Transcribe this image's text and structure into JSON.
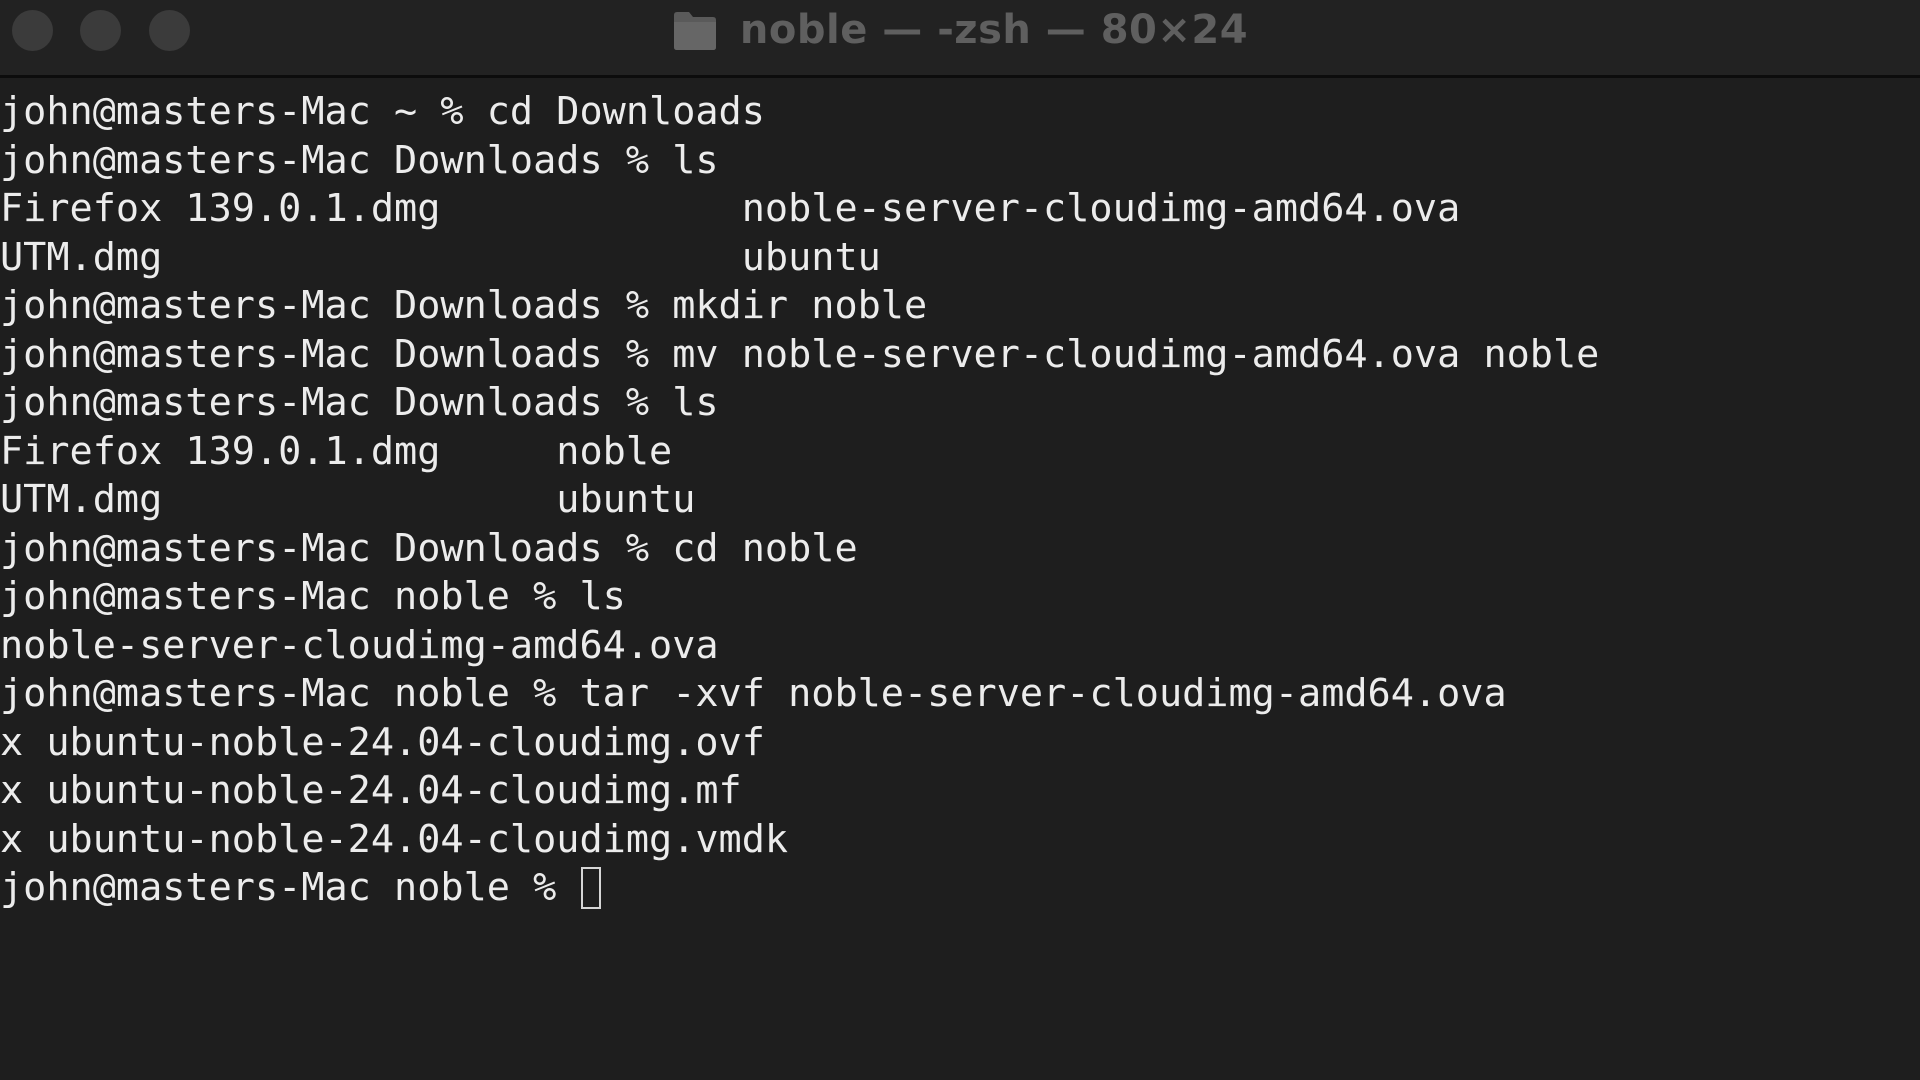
{
  "window": {
    "title": "noble — -zsh — 80×24",
    "title_icon": "folder-icon",
    "buttons": [
      "close",
      "minimize",
      "zoom"
    ]
  },
  "colors": {
    "background": "#1e1e1e",
    "titlebar": "#222222",
    "text": "#ececec",
    "title_text": "#5f5f5f",
    "traffic_light": "#3b3b3b"
  },
  "terminal": {
    "lines": [
      "john@masters-Mac ~ % cd Downloads",
      "john@masters-Mac Downloads % ls",
      "Firefox 139.0.1.dmg             noble-server-cloudimg-amd64.ova",
      "UTM.dmg                         ubuntu",
      "john@masters-Mac Downloads % mkdir noble",
      "john@masters-Mac Downloads % mv noble-server-cloudimg-amd64.ova noble",
      "john@masters-Mac Downloads % ls",
      "Firefox 139.0.1.dmg     noble",
      "UTM.dmg                 ubuntu",
      "john@masters-Mac Downloads % cd noble",
      "john@masters-Mac noble % ls",
      "noble-server-cloudimg-amd64.ova",
      "john@masters-Mac noble % tar -xvf noble-server-cloudimg-amd64.ova",
      "x ubuntu-noble-24.04-cloudimg.ovf",
      "x ubuntu-noble-24.04-cloudimg.mf",
      "x ubuntu-noble-24.04-cloudimg.vmdk"
    ],
    "prompt": "john@masters-Mac noble % "
  }
}
